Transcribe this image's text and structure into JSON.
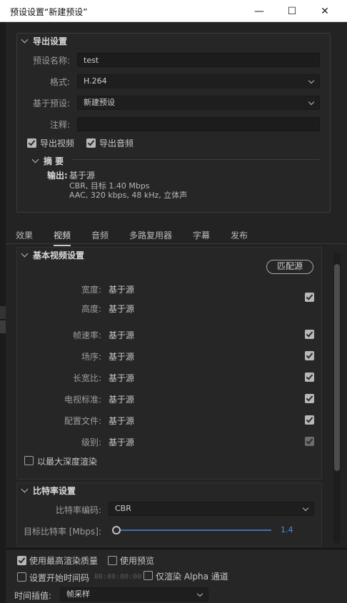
{
  "window": {
    "title": "预设设置“新建预设”",
    "minimize": "—",
    "maximize": "☐",
    "close": "✕"
  },
  "export_settings": {
    "header": "导出设置",
    "preset_name_label": "预设名称:",
    "preset_name_value": "test",
    "format_label": "格式:",
    "format_value": "H.264",
    "based_on_label": "基于预设:",
    "based_on_value": "新建预设",
    "comments_label": "注释:",
    "comments_value": "",
    "export_video_label": "导出视频",
    "export_video_checked": true,
    "export_audio_label": "导出音频",
    "export_audio_checked": true,
    "summary": {
      "header": "摘 要",
      "output_label": "输出:",
      "output_value": "基于源",
      "line2": "CBR, 目标 1.40 Mbps",
      "line3": "AAC, 320 kbps, 48 kHz, 立体声"
    }
  },
  "tabs": [
    {
      "label": "效果",
      "active": false
    },
    {
      "label": "视频",
      "active": true
    },
    {
      "label": "音频",
      "active": false
    },
    {
      "label": "多路复用器",
      "active": false
    },
    {
      "label": "字幕",
      "active": false
    },
    {
      "label": "发布",
      "active": false
    }
  ],
  "basic_video": {
    "header": "基本视频设置",
    "match_source_button": "匹配源",
    "rows": [
      {
        "label": "宽度:",
        "value": "基于源"
      },
      {
        "label": "高度:",
        "value": "基于源"
      },
      {
        "label": "帧速率:",
        "value": "基于源",
        "checked": true
      },
      {
        "label": "场序:",
        "value": "基于源",
        "checked": true
      },
      {
        "label": "长宽比:",
        "value": "基于源",
        "checked": true
      },
      {
        "label": "电视标准:",
        "value": "基于源",
        "checked": true
      },
      {
        "label": "配置文件:",
        "value": "基于源",
        "checked": true
      },
      {
        "label": "级别:",
        "value": "基于源",
        "checked": true,
        "disabled": true
      }
    ],
    "size_checked": true,
    "max_depth_label": "以最大深度渲染",
    "max_depth_checked": false
  },
  "bitrate": {
    "header": "比特率设置",
    "encoding_label": "比特率编码:",
    "encoding_value": "CBR",
    "target_label": "目标比特率 [Mbps]:",
    "target_value": "1.4",
    "target_fraction": 0.0
  },
  "bottom": {
    "max_quality_label": "使用最高渲染质量",
    "max_quality_checked": true,
    "use_preview_label": "使用预览",
    "use_preview_checked": false,
    "set_start_tc_label": "设置开始时间码",
    "set_start_tc_checked": false,
    "start_tc_value": "00:00:00:00",
    "alpha_only_label": "仅渲染 Alpha 通道",
    "alpha_only_checked": false,
    "time_interp_label": "时间插值:",
    "time_interp_value": "帧采样"
  }
}
